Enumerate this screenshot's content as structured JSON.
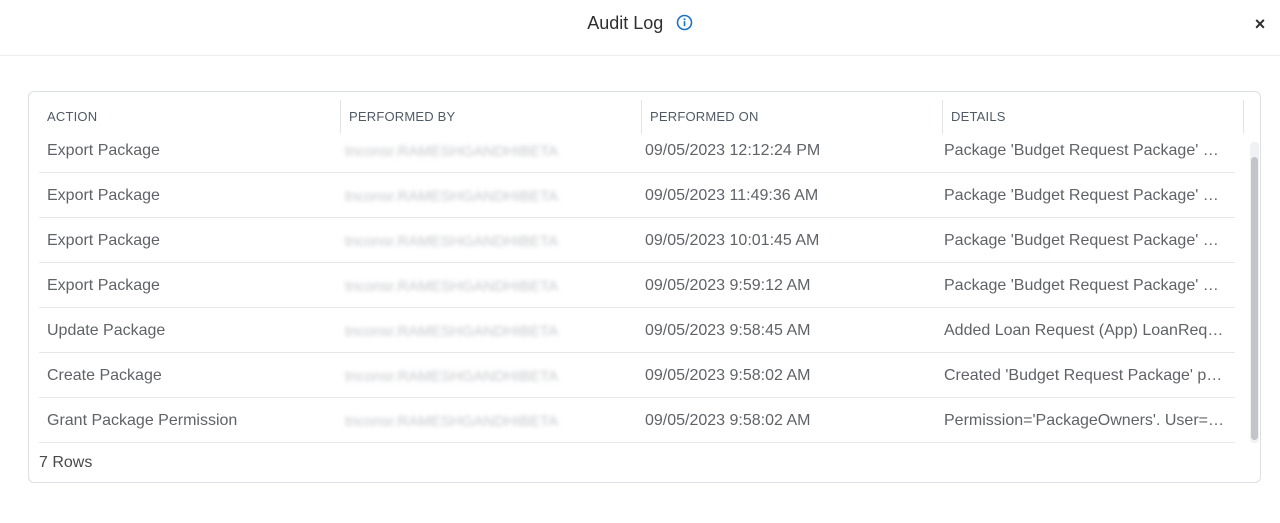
{
  "header": {
    "title": "Audit Log",
    "info_icon": "info-circle-icon",
    "close_label": "×",
    "accent_color": "#1a73c9"
  },
  "table": {
    "columns": [
      "ACTION",
      "PERFORMED BY",
      "PERFORMED ON",
      "DETAILS"
    ],
    "rows": [
      {
        "action": "Export Package",
        "performed_by": "tnconsr.RAMESHGANDHIBETA",
        "performed_on": "09/05/2023 12:12:24 PM",
        "details": "Package 'Budget Request Package' ve..."
      },
      {
        "action": "Export Package",
        "performed_by": "tnconsr.RAMESHGANDHIBETA",
        "performed_on": "09/05/2023 11:49:36 AM",
        "details": "Package 'Budget Request Package' ve..."
      },
      {
        "action": "Export Package",
        "performed_by": "tnconsr.RAMESHGANDHIBETA",
        "performed_on": "09/05/2023 10:01:45 AM",
        "details": "Package 'Budget Request Package' ve..."
      },
      {
        "action": "Export Package",
        "performed_by": "tnconsr.RAMESHGANDHIBETA",
        "performed_on": "09/05/2023 9:59:12 AM",
        "details": "Package 'Budget Request Package' ve..."
      },
      {
        "action": "Update Package",
        "performed_by": "tnconsr.RAMESHGANDHIBETA",
        "performed_on": "09/05/2023 9:58:45 AM",
        "details": "Added Loan Request (App) LoanRequ..."
      },
      {
        "action": "Create Package",
        "performed_by": "tnconsr.RAMESHGANDHIBETA",
        "performed_on": "09/05/2023 9:58:02 AM",
        "details": "Created 'Budget Request Package' pa..."
      },
      {
        "action": "Grant Package Permission",
        "performed_by": "tnconsr.RAMESHGANDHIBETA",
        "performed_on": "09/05/2023 9:58:02 AM",
        "details": "Permission='PackageOwners'. User='n..."
      }
    ]
  },
  "footer": {
    "row_count": "7 Rows"
  }
}
